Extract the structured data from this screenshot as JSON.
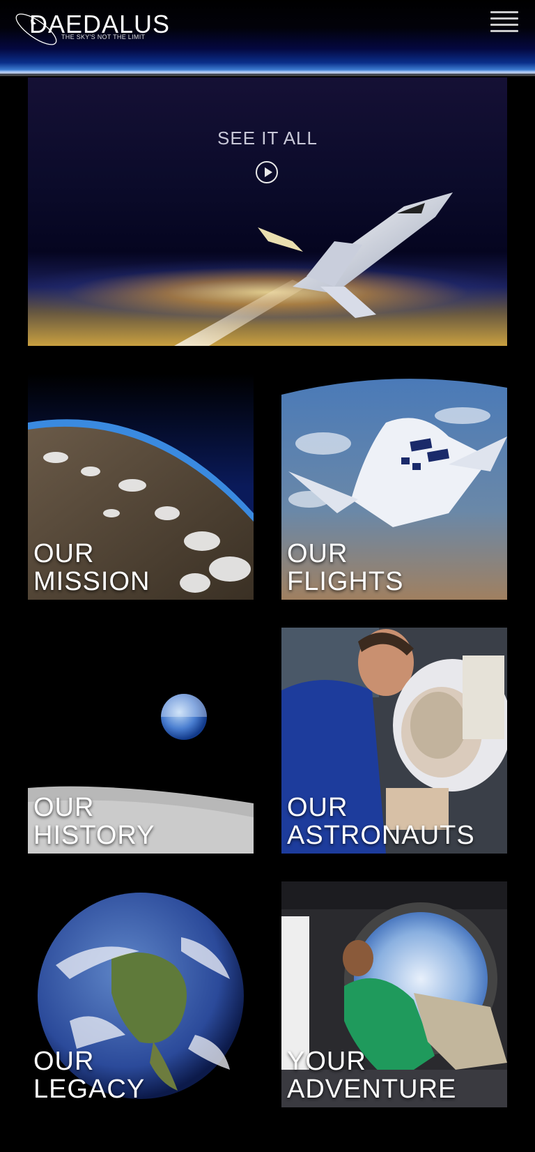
{
  "header": {
    "logo_text": "DAEDALUS",
    "logo_tagline": "THE SKY'S NOT THE LIMIT",
    "menu_icon": "hamburger-menu-icon"
  },
  "hero": {
    "title": "SEE IT ALL",
    "play_icon": "play-circle-icon"
  },
  "tiles": [
    {
      "line1": "OUR",
      "line2": "MISSION"
    },
    {
      "line1": "OUR",
      "line2": "FLIGHTS"
    },
    {
      "line1": "OUR",
      "line2": "HISTORY"
    },
    {
      "line1": "OUR",
      "line2": "ASTRONAUTS"
    },
    {
      "line1": "OUR",
      "line2": "LEGACY"
    },
    {
      "line1": "YOUR",
      "line2": "ADVENTURE"
    }
  ],
  "colors": {
    "background": "#000000",
    "header_glow": "#3c7bd0",
    "text": "#ffffff"
  }
}
